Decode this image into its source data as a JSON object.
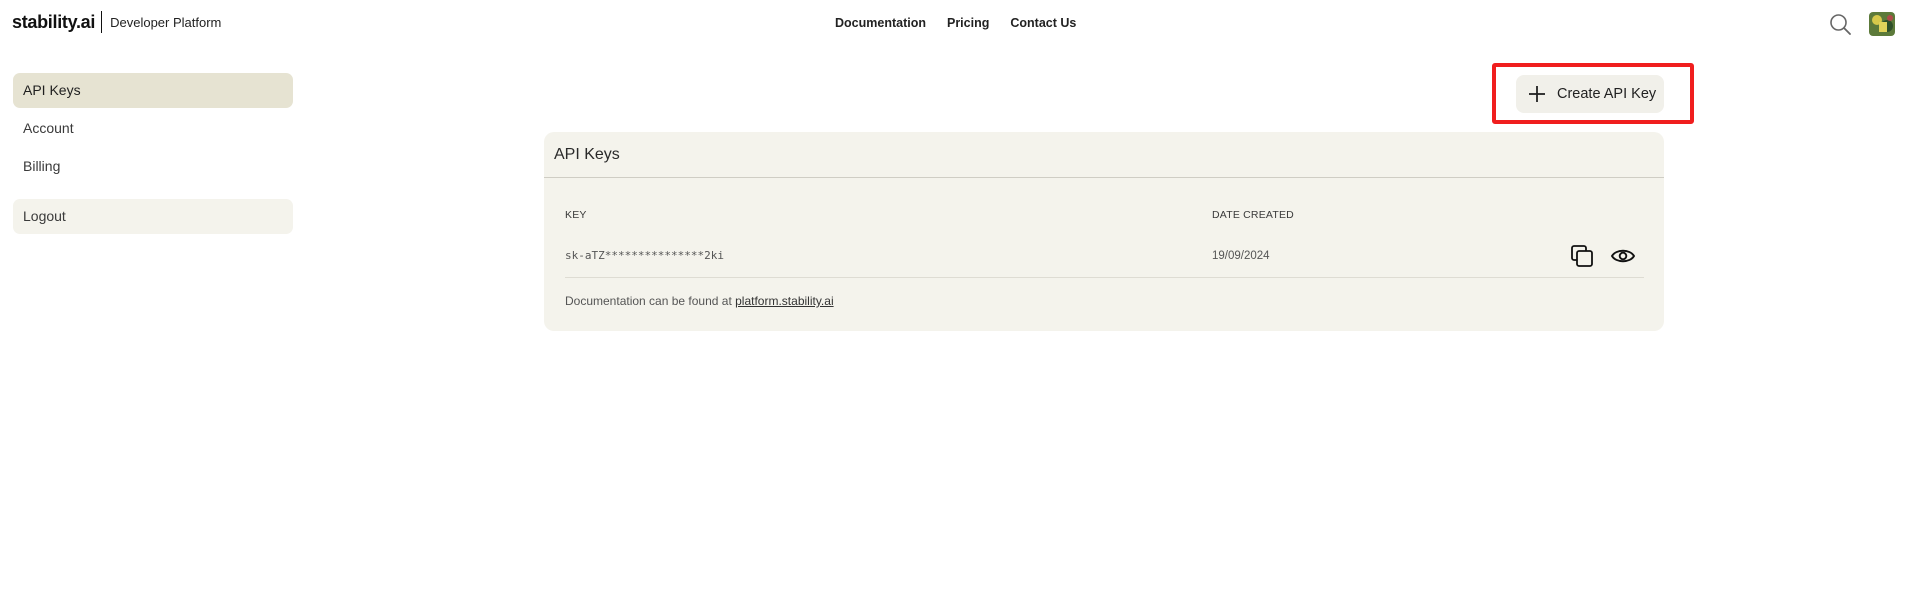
{
  "header": {
    "brand": "stability.ai",
    "brand_sub": "Developer Platform",
    "nav": [
      "Documentation",
      "Pricing",
      "Contact Us"
    ]
  },
  "sidebar": {
    "items": [
      {
        "label": "API Keys",
        "active": true
      },
      {
        "label": "Account",
        "active": false
      },
      {
        "label": "Billing",
        "active": false
      }
    ],
    "logout": "Logout"
  },
  "main": {
    "create_button": "Create API Key",
    "card": {
      "title": "API Keys",
      "columns": [
        "KEY",
        "DATE CREATED"
      ],
      "rows": [
        {
          "key": "sk-aTZ***************2ki",
          "date": "19/09/2024"
        }
      ],
      "note_prefix": "Documentation can be found at",
      "note_link": "platform.stability.ai"
    }
  },
  "colors": {
    "accent_active": "#e6e3d2",
    "card_bg": "#f4f3ec",
    "highlight": "#f01e1e"
  },
  "icons": [
    "search-icon",
    "avatar",
    "plus-icon",
    "copy-icon",
    "eye-icon"
  ]
}
